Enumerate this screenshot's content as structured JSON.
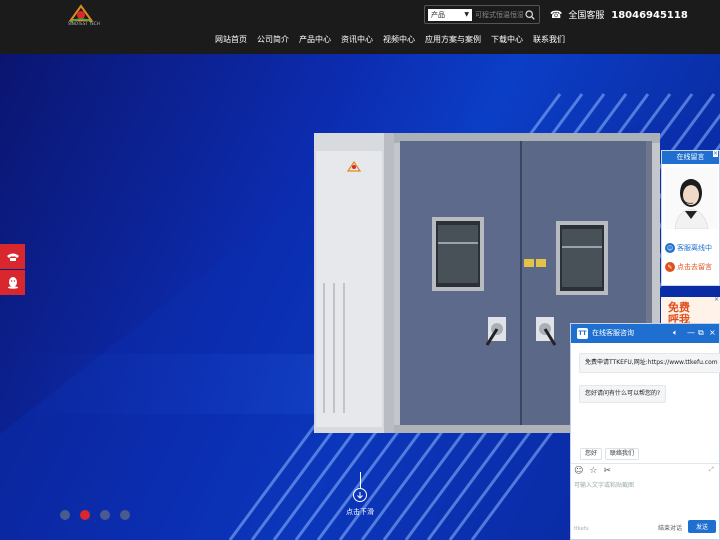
{
  "brand": {
    "logo_caption": "SINOTEST TECH",
    "colors": {
      "header_bg": "#1b1b1b",
      "accent_red": "#d9272e",
      "accent_blue": "#1e6fd0"
    }
  },
  "search": {
    "category": "产品",
    "placeholder": "可程式恒温恒湿"
  },
  "hotline": {
    "label": "全国客服",
    "number": "18046945118"
  },
  "nav": {
    "items": [
      "网站首页",
      "公司简介",
      "产品中心",
      "资讯中心",
      "视频中心",
      "应用方案与案例",
      "下载中心",
      "联系我们"
    ]
  },
  "hero": {
    "scroll_label": "点击下滑",
    "slides": [
      {
        "active": false
      },
      {
        "active": true
      },
      {
        "active": false
      },
      {
        "active": false
      }
    ],
    "chamber_logo_caption": "SINOTEST"
  },
  "side_float": {
    "icons": [
      "phone-icon",
      "qq-icon"
    ]
  },
  "message_widget": {
    "title": "在线留言",
    "close": "×",
    "rows": [
      "客服离线中",
      "点击去留言"
    ]
  },
  "free_call": {
    "line1": "免费",
    "line2": "呼我",
    "close": "×"
  },
  "chat": {
    "title": "在线客服咨询",
    "logo": "TT",
    "intro_message": "免费申请TTKEFU,网址:https://www.ttkefu.com",
    "greeting": "您好请问有什么可以帮您的?",
    "quick_replies": [
      "您好",
      "联络我们"
    ],
    "input_placeholder": "可输入文字或粘贴截图",
    "brand": "ttkefu",
    "end_label": "结束对话",
    "send_label": "发送"
  }
}
